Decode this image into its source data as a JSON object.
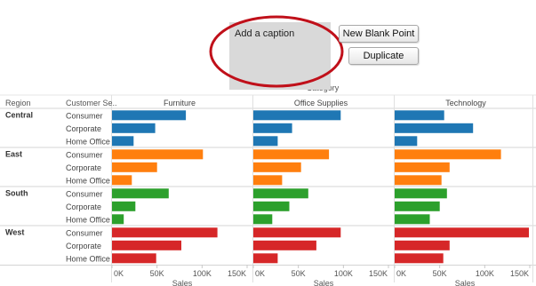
{
  "caption": {
    "text": "Add a caption"
  },
  "buttons": {
    "new_blank_point": "New Blank Point",
    "duplicate": "Duplicate"
  },
  "colors": {
    "Central": "#1f77b4",
    "East": "#ff7f0e",
    "South": "#2ca02c",
    "West": "#d62728",
    "caption_highlight": "#c0101a",
    "caption_box": "#d9d9d9"
  },
  "chart_data": {
    "type": "bar",
    "orientation": "horizontal",
    "header_title": "Category",
    "row_headers": [
      "Region",
      "Customer Se.."
    ],
    "columns": [
      "Furniture",
      "Office Supplies",
      "Technology"
    ],
    "regions": [
      "Central",
      "East",
      "South",
      "West"
    ],
    "segments": [
      "Consumer",
      "Corporate",
      "Home Office"
    ],
    "values": {
      "Central": {
        "Furniture": [
          82000,
          48000,
          24000
        ],
        "Office Supplies": [
          97000,
          43000,
          27000
        ],
        "Technology": [
          55000,
          87000,
          25000
        ]
      },
      "East": {
        "Furniture": [
          101000,
          50000,
          22000
        ],
        "Office Supplies": [
          84000,
          53000,
          32000
        ],
        "Technology": [
          118000,
          61000,
          52000
        ]
      },
      "South": {
        "Furniture": [
          63000,
          26000,
          13000
        ],
        "Office Supplies": [
          61000,
          40000,
          21000
        ],
        "Technology": [
          58000,
          50000,
          39000
        ]
      },
      "West": {
        "Furniture": [
          117000,
          77000,
          49000
        ],
        "Office Supplies": [
          97000,
          70000,
          27000
        ],
        "Technology": [
          149000,
          61000,
          54000
        ]
      }
    },
    "x_ticks": [
      "0K",
      "50K",
      "100K",
      "150K"
    ],
    "x_tick_values": [
      0,
      50000,
      100000,
      150000
    ],
    "xlabel": "Sales",
    "xlim": [
      0,
      150000
    ],
    "grid": false,
    "legend": "none"
  }
}
